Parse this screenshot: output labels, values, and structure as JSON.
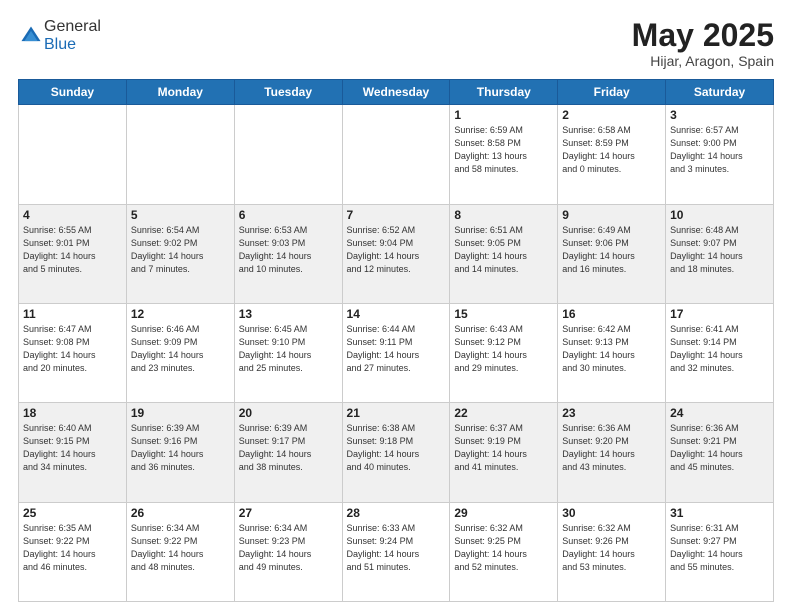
{
  "header": {
    "logo_general": "General",
    "logo_blue": "Blue",
    "month_title": "May 2025",
    "location": "Hijar, Aragon, Spain"
  },
  "days_of_week": [
    "Sunday",
    "Monday",
    "Tuesday",
    "Wednesday",
    "Thursday",
    "Friday",
    "Saturday"
  ],
  "weeks": [
    [
      {
        "day": "",
        "info": ""
      },
      {
        "day": "",
        "info": ""
      },
      {
        "day": "",
        "info": ""
      },
      {
        "day": "",
        "info": ""
      },
      {
        "day": "1",
        "info": "Sunrise: 6:59 AM\nSunset: 8:58 PM\nDaylight: 13 hours\nand 58 minutes."
      },
      {
        "day": "2",
        "info": "Sunrise: 6:58 AM\nSunset: 8:59 PM\nDaylight: 14 hours\nand 0 minutes."
      },
      {
        "day": "3",
        "info": "Sunrise: 6:57 AM\nSunset: 9:00 PM\nDaylight: 14 hours\nand 3 minutes."
      }
    ],
    [
      {
        "day": "4",
        "info": "Sunrise: 6:55 AM\nSunset: 9:01 PM\nDaylight: 14 hours\nand 5 minutes."
      },
      {
        "day": "5",
        "info": "Sunrise: 6:54 AM\nSunset: 9:02 PM\nDaylight: 14 hours\nand 7 minutes."
      },
      {
        "day": "6",
        "info": "Sunrise: 6:53 AM\nSunset: 9:03 PM\nDaylight: 14 hours\nand 10 minutes."
      },
      {
        "day": "7",
        "info": "Sunrise: 6:52 AM\nSunset: 9:04 PM\nDaylight: 14 hours\nand 12 minutes."
      },
      {
        "day": "8",
        "info": "Sunrise: 6:51 AM\nSunset: 9:05 PM\nDaylight: 14 hours\nand 14 minutes."
      },
      {
        "day": "9",
        "info": "Sunrise: 6:49 AM\nSunset: 9:06 PM\nDaylight: 14 hours\nand 16 minutes."
      },
      {
        "day": "10",
        "info": "Sunrise: 6:48 AM\nSunset: 9:07 PM\nDaylight: 14 hours\nand 18 minutes."
      }
    ],
    [
      {
        "day": "11",
        "info": "Sunrise: 6:47 AM\nSunset: 9:08 PM\nDaylight: 14 hours\nand 20 minutes."
      },
      {
        "day": "12",
        "info": "Sunrise: 6:46 AM\nSunset: 9:09 PM\nDaylight: 14 hours\nand 23 minutes."
      },
      {
        "day": "13",
        "info": "Sunrise: 6:45 AM\nSunset: 9:10 PM\nDaylight: 14 hours\nand 25 minutes."
      },
      {
        "day": "14",
        "info": "Sunrise: 6:44 AM\nSunset: 9:11 PM\nDaylight: 14 hours\nand 27 minutes."
      },
      {
        "day": "15",
        "info": "Sunrise: 6:43 AM\nSunset: 9:12 PM\nDaylight: 14 hours\nand 29 minutes."
      },
      {
        "day": "16",
        "info": "Sunrise: 6:42 AM\nSunset: 9:13 PM\nDaylight: 14 hours\nand 30 minutes."
      },
      {
        "day": "17",
        "info": "Sunrise: 6:41 AM\nSunset: 9:14 PM\nDaylight: 14 hours\nand 32 minutes."
      }
    ],
    [
      {
        "day": "18",
        "info": "Sunrise: 6:40 AM\nSunset: 9:15 PM\nDaylight: 14 hours\nand 34 minutes."
      },
      {
        "day": "19",
        "info": "Sunrise: 6:39 AM\nSunset: 9:16 PM\nDaylight: 14 hours\nand 36 minutes."
      },
      {
        "day": "20",
        "info": "Sunrise: 6:39 AM\nSunset: 9:17 PM\nDaylight: 14 hours\nand 38 minutes."
      },
      {
        "day": "21",
        "info": "Sunrise: 6:38 AM\nSunset: 9:18 PM\nDaylight: 14 hours\nand 40 minutes."
      },
      {
        "day": "22",
        "info": "Sunrise: 6:37 AM\nSunset: 9:19 PM\nDaylight: 14 hours\nand 41 minutes."
      },
      {
        "day": "23",
        "info": "Sunrise: 6:36 AM\nSunset: 9:20 PM\nDaylight: 14 hours\nand 43 minutes."
      },
      {
        "day": "24",
        "info": "Sunrise: 6:36 AM\nSunset: 9:21 PM\nDaylight: 14 hours\nand 45 minutes."
      }
    ],
    [
      {
        "day": "25",
        "info": "Sunrise: 6:35 AM\nSunset: 9:22 PM\nDaylight: 14 hours\nand 46 minutes."
      },
      {
        "day": "26",
        "info": "Sunrise: 6:34 AM\nSunset: 9:22 PM\nDaylight: 14 hours\nand 48 minutes."
      },
      {
        "day": "27",
        "info": "Sunrise: 6:34 AM\nSunset: 9:23 PM\nDaylight: 14 hours\nand 49 minutes."
      },
      {
        "day": "28",
        "info": "Sunrise: 6:33 AM\nSunset: 9:24 PM\nDaylight: 14 hours\nand 51 minutes."
      },
      {
        "day": "29",
        "info": "Sunrise: 6:32 AM\nSunset: 9:25 PM\nDaylight: 14 hours\nand 52 minutes."
      },
      {
        "day": "30",
        "info": "Sunrise: 6:32 AM\nSunset: 9:26 PM\nDaylight: 14 hours\nand 53 minutes."
      },
      {
        "day": "31",
        "info": "Sunrise: 6:31 AM\nSunset: 9:27 PM\nDaylight: 14 hours\nand 55 minutes."
      }
    ]
  ]
}
